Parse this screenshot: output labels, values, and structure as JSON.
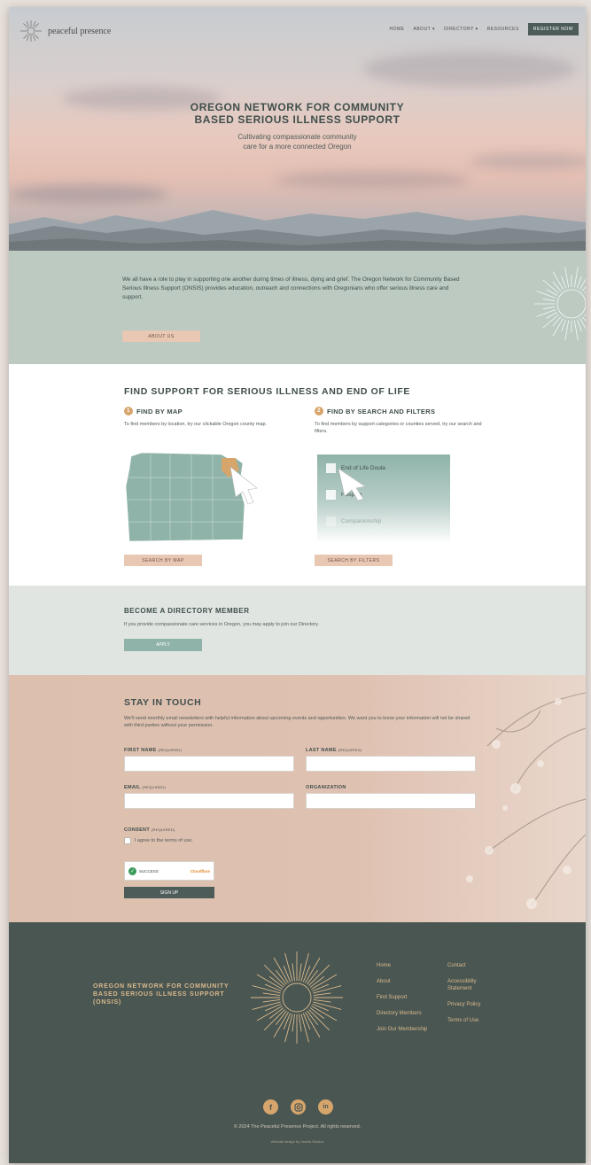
{
  "header": {
    "logo_text": "peaceful presence",
    "nav": [
      "HOME",
      "ABOUT ▾",
      "DIRECTORY ▾",
      "RESOURCES"
    ],
    "join_label": "REGISTER NOW"
  },
  "hero": {
    "title_line1": "OREGON NETWORK FOR COMMUNITY",
    "title_line2": "BASED SERIOUS ILLNESS SUPPORT",
    "sub_line1": "Cultivating compassionate community",
    "sub_line2": "care for a more connected Oregon"
  },
  "intro": {
    "text": "We all have a role to play in supporting one another during times of illness, dying and grief. The Oregon Network for Community Based Serious Illness Support (ONSIS) provides education, outreach and connections with Oregonians who offer serious illness care and support.",
    "button": "ABOUT US"
  },
  "find": {
    "heading": "FIND SUPPORT FOR SERIOUS ILLNESS AND END OF LIFE",
    "map": {
      "number": "1",
      "title": "FIND BY MAP",
      "desc": "To find members by location, try our clickable Oregon county map.",
      "button": "SEARCH BY MAP"
    },
    "search": {
      "number": "2",
      "title": "FIND BY SEARCH AND FILTERS",
      "desc": "To find members by support categories or counties served, try our search and filters.",
      "filters": [
        "End of Life Doula",
        "Hospice",
        "Companionship"
      ],
      "button": "SEARCH BY FILTERS"
    }
  },
  "directory": {
    "heading": "BECOME A DIRECTORY MEMBER",
    "desc": "If you provide compassionate care services in Oregon, you may apply to join our Directory.",
    "button": "APPLY"
  },
  "touch": {
    "heading": "STAY IN TOUCH",
    "desc": "We'll send monthly email newsletters with helpful information about upcoming events and opportunities. We want you to know your information will not be shared with third parties without your permission.",
    "first_name": "FIRST NAME",
    "last_name": "LAST NAME",
    "email": "EMAIL",
    "organization": "ORGANIZATION",
    "required": "(required)",
    "consent": "CONSENT",
    "consent_text": "I agree to the terms of use.",
    "captcha_left": "SUCCESS",
    "captcha_right": "Cloudflare",
    "submit": "SIGN UP"
  },
  "footer": {
    "title": "OREGON NETWORK FOR COMMUNITY BASED SERIOUS ILLNESS SUPPORT (ONSIS)",
    "col1": [
      "Home",
      "About",
      "Find Support",
      "Directory Members",
      "Join Our Membership"
    ],
    "col2": [
      "Contact",
      "Accessibility Statement",
      "Privacy Policy",
      "Terms of Use"
    ],
    "copyright": "© 2024 The Peaceful Presence Project. All rights reserved.",
    "credit": "Website design by Vanilla Studios"
  },
  "colors": {
    "sage": "#bccac2",
    "peach": "#e8c7b3",
    "footer": "#4a5652",
    "gold": "#d6a56c"
  }
}
